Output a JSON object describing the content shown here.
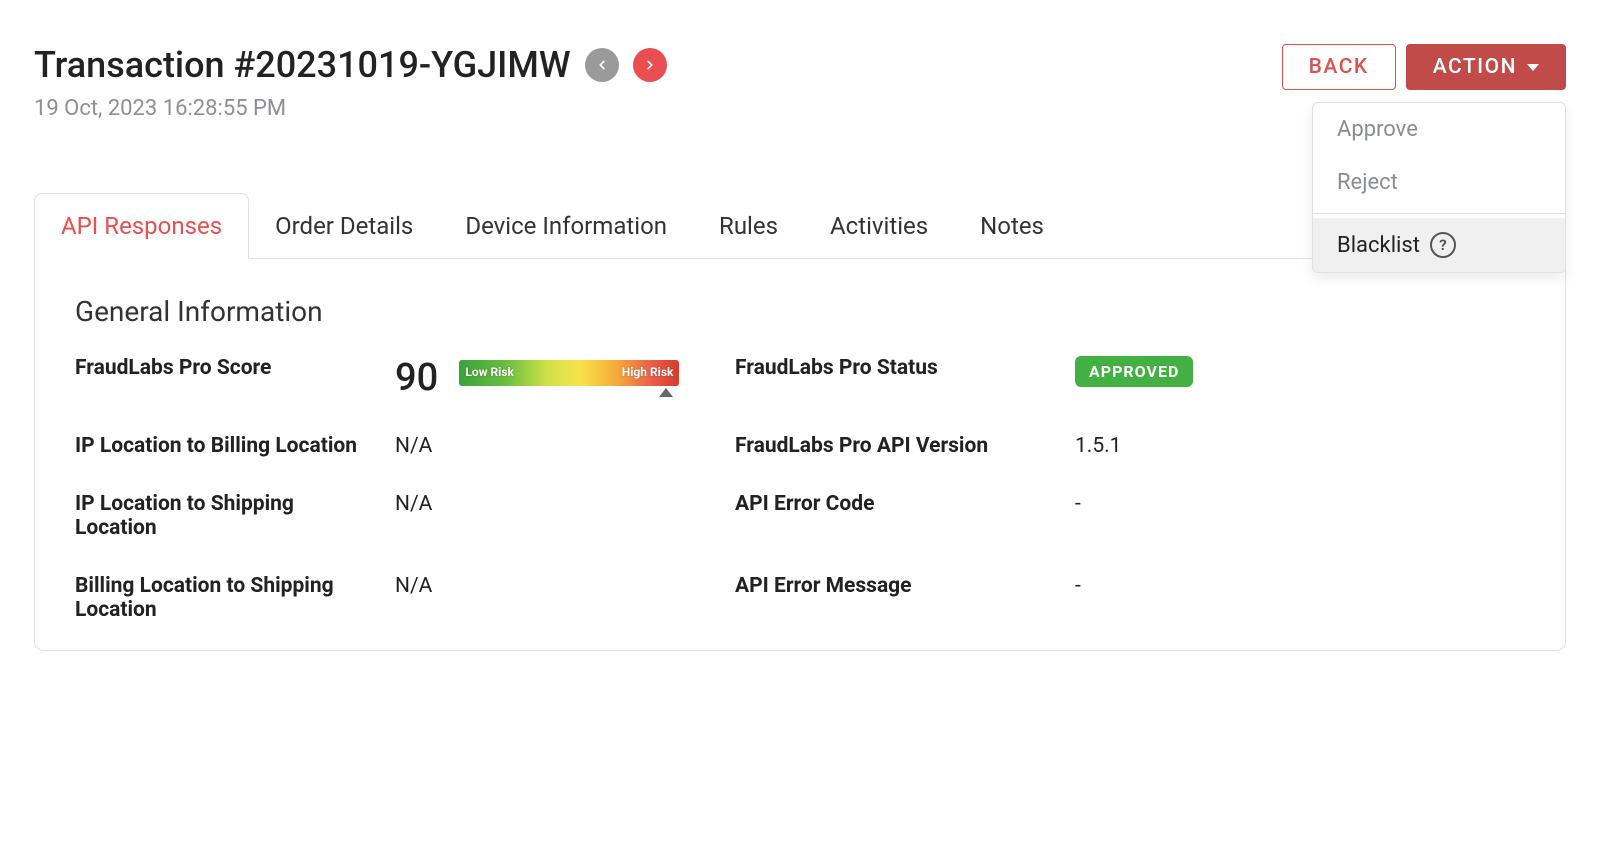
{
  "header": {
    "title": "Transaction #20231019-YGJIMW",
    "subtitle": "19 Oct, 2023 16:28:55 PM"
  },
  "buttons": {
    "back": "BACK",
    "action": "ACTION"
  },
  "dropdown": {
    "approve": "Approve",
    "reject": "Reject",
    "blacklist": "Blacklist"
  },
  "tabs": [
    {
      "key": "api",
      "label": "API Responses",
      "active": true
    },
    {
      "key": "order",
      "label": "Order Details",
      "active": false
    },
    {
      "key": "device",
      "label": "Device Information",
      "active": false
    },
    {
      "key": "rules",
      "label": "Rules",
      "active": false
    },
    {
      "key": "activities",
      "label": "Activities",
      "active": false
    },
    {
      "key": "notes",
      "label": "Notes",
      "active": false
    }
  ],
  "section": {
    "title": "General Information"
  },
  "riskBar": {
    "lowLabel": "Low Risk",
    "highLabel": "High Risk"
  },
  "fields": {
    "left": [
      {
        "label": "FraudLabs Pro Score",
        "value": "90",
        "type": "score"
      },
      {
        "label": "IP Location to Billing Location",
        "value": "N/A",
        "type": "text"
      },
      {
        "label": "IP Location to Shipping Location",
        "value": "N/A",
        "type": "text"
      },
      {
        "label": "Billing Location to Shipping Location",
        "value": "N/A",
        "type": "text"
      }
    ],
    "right": [
      {
        "label": "FraudLabs Pro Status",
        "value": "APPROVED",
        "type": "badge"
      },
      {
        "label": "FraudLabs Pro API Version",
        "value": "1.5.1",
        "type": "text"
      },
      {
        "label": "API Error Code",
        "value": "-",
        "type": "text"
      },
      {
        "label": "API Error Message",
        "value": "-",
        "type": "text"
      }
    ]
  }
}
